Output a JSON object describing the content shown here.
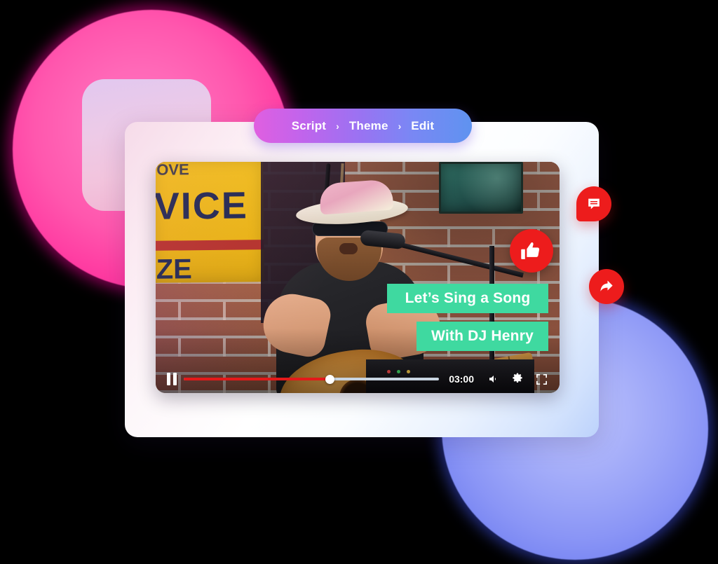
{
  "breadcrumb": {
    "items": [
      {
        "label": "Script"
      },
      {
        "label": "Theme"
      },
      {
        "label": "Edit"
      }
    ],
    "separator": "›",
    "gradient_from": "#E05FE0",
    "gradient_to": "#5F93F0"
  },
  "video": {
    "scene_description": "Bearded musician in a white hat and sunglasses singing into a microphone while playing an acoustic guitar in front of a brick wall",
    "sign": {
      "top_text": "OVE",
      "main_text": "VICE",
      "bottom_text": "ZE"
    },
    "captions": [
      {
        "text": "Let’s Sing a Song",
        "color": "#3FD9A0"
      },
      {
        "text": "With DJ Henry",
        "color": "#3FD9A0"
      }
    ],
    "like_badge": {
      "icon": "thumbs-up-icon",
      "color": "#ED1C1C"
    }
  },
  "controls": {
    "play_pause": {
      "icon": "pause-icon",
      "state": "playing"
    },
    "progress_percent": 57,
    "time": "03:00",
    "volume": {
      "icon": "volume-icon"
    },
    "settings": {
      "icon": "gear-icon"
    },
    "fullscreen": {
      "icon": "fullscreen-icon"
    },
    "progress_played_color": "#E4191A",
    "progress_remaining_color": "#C8D4E0"
  },
  "floating_actions": [
    {
      "name": "comment",
      "icon": "comment-icon",
      "color": "#ED1C1C"
    },
    {
      "name": "share",
      "icon": "share-arrow-icon",
      "color": "#ED1C1C"
    }
  ],
  "decor": {
    "pink_blob_color": "#FF57AE",
    "blue_blob_color": "#8A95F6",
    "card_background": "#FFFFFF"
  }
}
